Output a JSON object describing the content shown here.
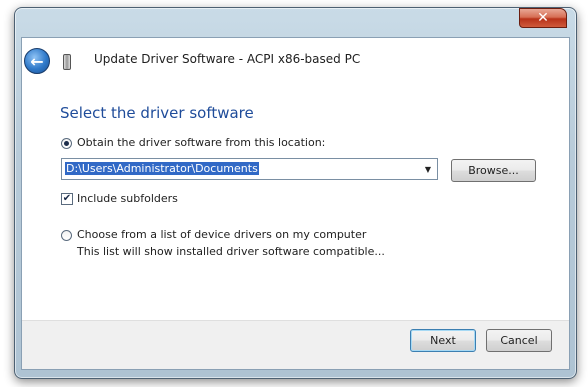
{
  "window": {
    "title": "Update Driver Software - ACPI x86-based PC",
    "close_glyph": "✕",
    "back_glyph": "←"
  },
  "main": {
    "heading": "Select the driver software",
    "option_location": {
      "label": "Obtain the driver software from this location:",
      "checked": true
    },
    "path": {
      "value": "D:\\Users\\Administrator\\Documents",
      "dropdown_glyph": "▼"
    },
    "browse_label": "Browse...",
    "include_subfolders": {
      "label": "Include subfolders",
      "checked": true,
      "glyph": "✔"
    },
    "option_list": {
      "label": "Choose from a list of device drivers on my computer",
      "description": "This list will show installed driver software compatible...",
      "checked": false
    }
  },
  "footer": {
    "next_label": "Next",
    "cancel_label": "Cancel"
  },
  "colors": {
    "heading": "#1f4c9a",
    "selection": "#3169c6"
  },
  "icons": [
    "back-arrow-icon",
    "device-icon",
    "close-icon",
    "chevron-down-icon",
    "checkmark-icon"
  ]
}
